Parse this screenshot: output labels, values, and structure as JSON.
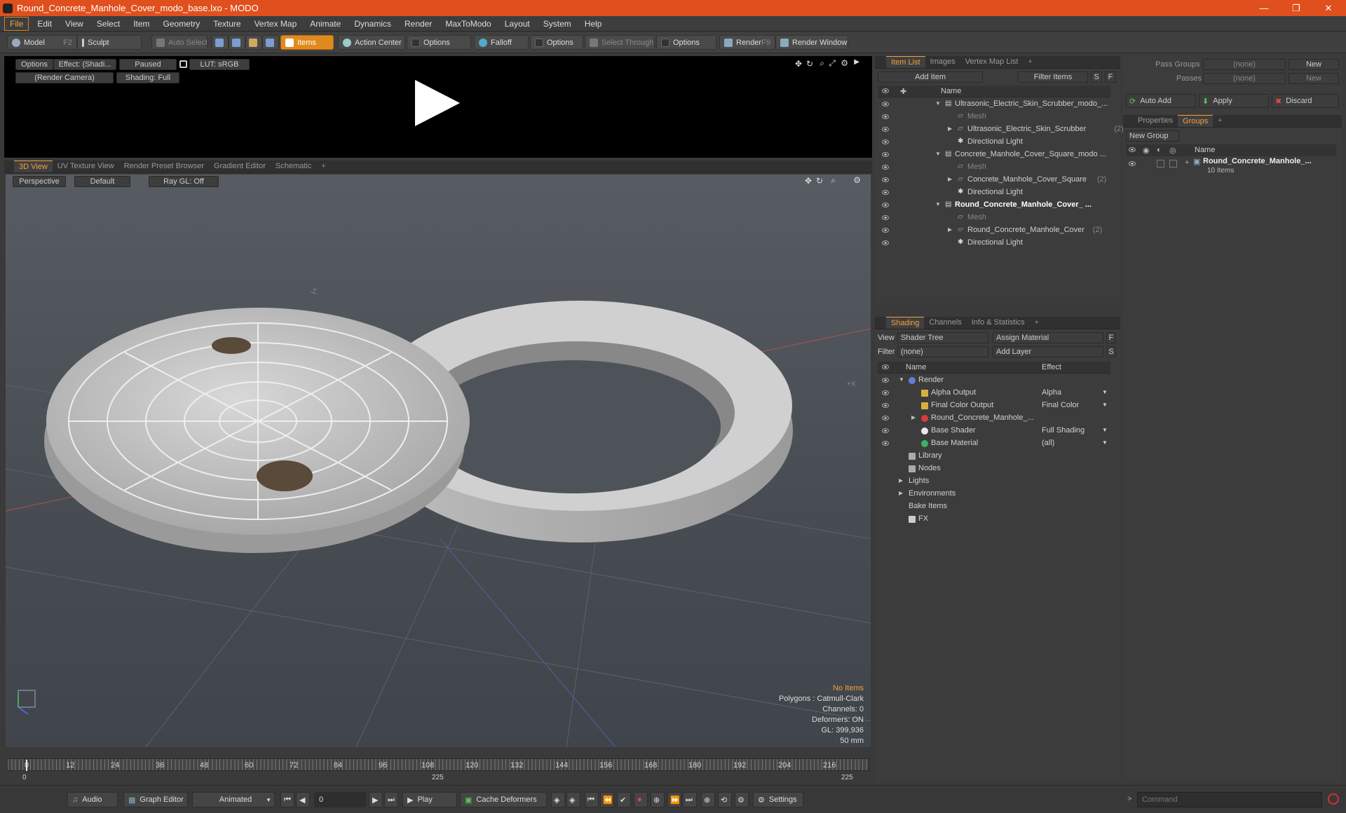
{
  "window": {
    "title": "Round_Concrete_Manhole_Cover_modo_base.lxo - MODO",
    "minimize": "—",
    "restore": "❐",
    "close": "✕"
  },
  "menu": [
    "File",
    "Edit",
    "View",
    "Select",
    "Item",
    "Geometry",
    "Texture",
    "Vertex Map",
    "Animate",
    "Dynamics",
    "Render",
    "MaxToModo",
    "Layout",
    "System",
    "Help"
  ],
  "toolbar": {
    "model": "Model",
    "model_key": "F2",
    "sculpt": "Sculpt",
    "auto_select": "Auto Select",
    "items": "Items",
    "action_center": "Action Center",
    "options1": "Options",
    "falloff": "Falloff",
    "options2": "Options",
    "select_through": "Select Through",
    "options3": "Options",
    "render": "Render",
    "render_key": "F9",
    "render_window": "Render Window"
  },
  "preview": {
    "options": "Options",
    "effect": "Effect: (Shadi...",
    "paused": "Paused",
    "lut": "LUT: sRGB",
    "camera": "(Render Camera)",
    "shading": "Shading: Full"
  },
  "viewport_tabs": [
    "3D View",
    "UV Texture View",
    "Render Preset Browser",
    "Gradient Editor",
    "Schematic",
    "+"
  ],
  "viewport": {
    "perspective": "Perspective",
    "default": "Default",
    "raygl": "Ray GL: Off",
    "axis_z": "-Z",
    "axis_x": "+X",
    "info": {
      "no_items": "No Items",
      "polygons": "Polygons : Catmull-Clark",
      "channels": "Channels: 0",
      "deformers": "Deformers: ON",
      "gl": "GL: 399,936",
      "scale": "50 mm"
    }
  },
  "timeline": {
    "ticks": [
      "0",
      "12",
      "24",
      "36",
      "48",
      "60",
      "72",
      "84",
      "96",
      "108",
      "120",
      "132",
      "144",
      "156",
      "168",
      "180",
      "192",
      "204",
      "216"
    ],
    "start": "0",
    "mid": "225",
    "end": "225"
  },
  "item_list": {
    "tabs": [
      "Item List",
      "Images",
      "Vertex Map List",
      "+"
    ],
    "add_item": "Add Item",
    "filter_items": "Filter Items",
    "s_btn": "S",
    "f_btn": "F",
    "col_name": "Name",
    "rows": [
      {
        "label": "Ultrasonic_Electric_Skin_Scrubber_modo_...",
        "indent": 0,
        "type": "scene",
        "bold": false,
        "dim": false,
        "count": ""
      },
      {
        "label": "Mesh",
        "indent": 1,
        "type": "mesh",
        "bold": false,
        "dim": true,
        "count": ""
      },
      {
        "label": "Ultrasonic_Electric_Skin_Scrubber",
        "indent": 1,
        "type": "group",
        "bold": false,
        "dim": false,
        "count": "(2)"
      },
      {
        "label": "Directional Light",
        "indent": 1,
        "type": "light",
        "bold": false,
        "dim": false,
        "count": ""
      },
      {
        "label": "Concrete_Manhole_Cover_Square_modo ...",
        "indent": 0,
        "type": "scene",
        "bold": false,
        "dim": false,
        "count": ""
      },
      {
        "label": "Mesh",
        "indent": 1,
        "type": "mesh",
        "bold": false,
        "dim": true,
        "count": ""
      },
      {
        "label": "Concrete_Manhole_Cover_Square",
        "indent": 1,
        "type": "group",
        "bold": false,
        "dim": false,
        "count": "(2)"
      },
      {
        "label": "Directional Light",
        "indent": 1,
        "type": "light",
        "bold": false,
        "dim": false,
        "count": ""
      },
      {
        "label": "Round_Concrete_Manhole_Cover_ ...",
        "indent": 0,
        "type": "scene",
        "bold": true,
        "dim": false,
        "count": ""
      },
      {
        "label": "Mesh",
        "indent": 1,
        "type": "mesh",
        "bold": false,
        "dim": true,
        "count": ""
      },
      {
        "label": "Round_Concrete_Manhole_Cover",
        "indent": 1,
        "type": "group",
        "bold": false,
        "dim": false,
        "count": "(2)"
      },
      {
        "label": "Directional Light",
        "indent": 1,
        "type": "light",
        "bold": false,
        "dim": false,
        "count": ""
      }
    ]
  },
  "shading": {
    "tabs": [
      "Shading",
      "Channels",
      "Info & Statistics",
      "+"
    ],
    "view_label": "View",
    "view_value": "Shader Tree",
    "assign_material": "Assign Material",
    "filter_label": "Filter",
    "filter_value": "(none)",
    "add_layer": "Add Layer",
    "f_btn": "F",
    "s_btn": "S",
    "col_name": "Name",
    "col_effect": "Effect",
    "rows": [
      {
        "label": "Render",
        "effect": "",
        "indent": 0,
        "icon": "render"
      },
      {
        "label": "Alpha Output",
        "effect": "Alpha",
        "indent": 1,
        "icon": "output"
      },
      {
        "label": "Final Color Output",
        "effect": "Final Color",
        "indent": 1,
        "icon": "output"
      },
      {
        "label": "Round_Concrete_Manhole_...",
        "effect": "",
        "indent": 1,
        "icon": "material-group"
      },
      {
        "label": "Base Shader",
        "effect": "Full Shading",
        "indent": 1,
        "icon": "shader"
      },
      {
        "label": "Base Material",
        "effect": "(all)",
        "indent": 1,
        "icon": "material"
      },
      {
        "label": "Library",
        "effect": "",
        "indent": 0,
        "icon": "folder"
      },
      {
        "label": "Nodes",
        "effect": "",
        "indent": 0,
        "icon": "folder"
      },
      {
        "label": "Lights",
        "effect": "",
        "indent": 0,
        "icon": "none"
      },
      {
        "label": "Environments",
        "effect": "",
        "indent": 0,
        "icon": "none"
      },
      {
        "label": "Bake Items",
        "effect": "",
        "indent": 0,
        "icon": "none"
      },
      {
        "label": "FX",
        "effect": "",
        "indent": 0,
        "icon": "fx"
      }
    ]
  },
  "groups_panel": {
    "pass_groups_label": "Pass Groups",
    "pass_groups_value": "(none)",
    "passes_label": "Passes",
    "passes_value": "(none)",
    "new1": "New",
    "new2": "New",
    "auto_add": "Auto Add",
    "apply": "Apply",
    "discard": "Discard",
    "tabs": [
      "Properties",
      "Groups",
      "+"
    ],
    "new_group": "New Group",
    "col_name": "Name",
    "group_name": "Round_Concrete_Manhole_...",
    "group_count": "10 Items"
  },
  "statusbar": {
    "audio": "Audio",
    "graph_editor": "Graph Editor",
    "animated": "Animated",
    "frame": "0",
    "play": "Play",
    "cache_deformers": "Cache Deformers",
    "settings": "Settings",
    "command_placeholder": "Command"
  }
}
